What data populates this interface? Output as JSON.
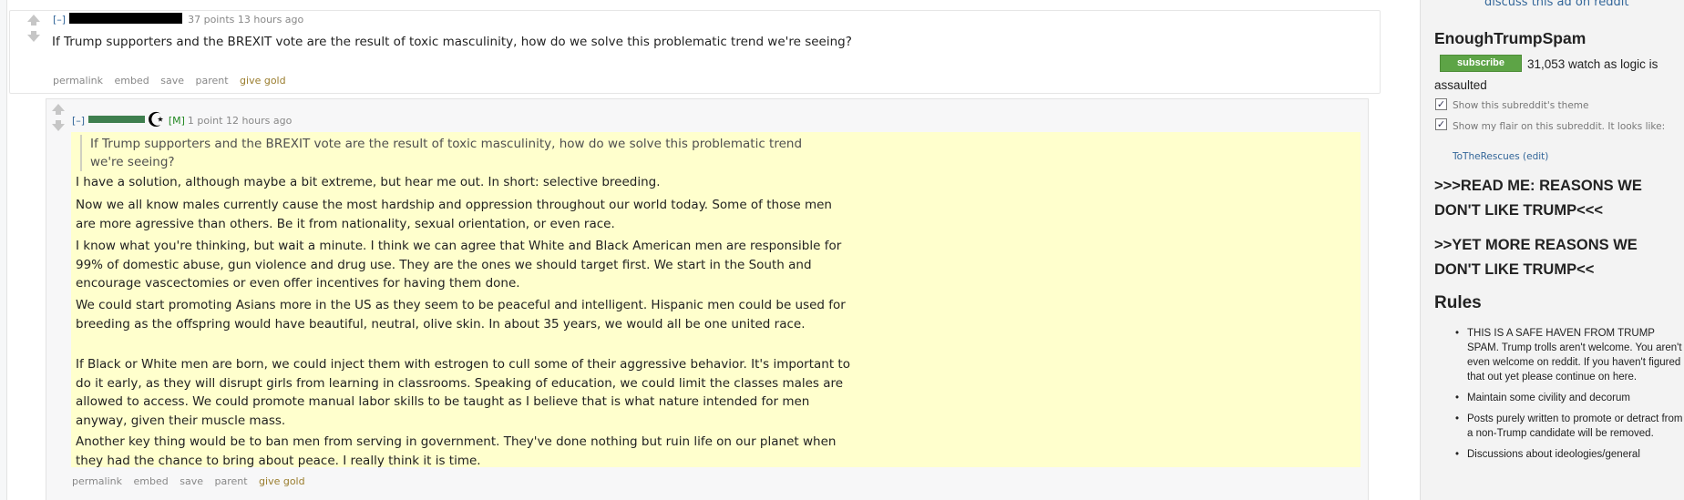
{
  "comment": {
    "expand_label": "[–]",
    "score": "37 points",
    "time": "13 hours ago",
    "body": "If Trump supporters and the BREXIT vote are the result of toxic masculinity, how do we solve this problematic trend we're seeing?",
    "actions": {
      "permalink": "permalink",
      "embed": "embed",
      "save": "save",
      "parent": "parent",
      "give_gold": "give gold"
    }
  },
  "reply": {
    "expand_label": "[–]",
    "mod_tag": "[M]",
    "score": "1 point",
    "time": "12 hours ago",
    "quote": "If Trump supporters and the BREXIT vote are the result of toxic masculinity, how do we solve this problematic trend we're seeing?",
    "paragraphs": [
      "I have a solution, although maybe a bit extreme, but hear me out. In short: selective breeding.",
      "Now we all know males currently cause the most hardship and oppression throughout our world today. Some of those men are more agressive than others. Be it from nationality, sexual orientation, or even race.",
      "I know what you're thinking, but wait a minute. I think we can agree that White and Black American men are responsible for 99% of domestic abuse, gun violence and drug use. They are the ones we should target first. We start in the South and encourage vascectomies or even offer incentives for having them done.",
      "We could start promoting Asians more in the US as they seem to be peaceful and intelligent. Hispanic men could be used for breeding as the offspring would have beautiful, neutral, olive skin. In about 35 years, we would all be one united race.",
      "If Black or White men are born, we could inject them with estrogen to cull some of their aggressive behavior. It's important to do it early, as they will disrupt girls from learning in classrooms. Speaking of education, we could limit the classes males are allowed to access. We could promote manual labor skills to be taught as I believe that is what nature intended for men anyway, given their muscle mass.",
      "Another key thing would be to ban men from serving in government. They've done nothing but ruin life on our planet when they had the chance to bring about peace. I really think it is time."
    ],
    "actions": {
      "permalink": "permalink",
      "embed": "embed",
      "save": "save",
      "parent": "parent",
      "give_gold": "give gold"
    }
  },
  "sidebar": {
    "ad_link": "discuss this ad on reddit",
    "subreddit_name": "EnoughTrumpSpam",
    "subscribe_label": "subscribe",
    "subscriber_text": "31,053 watch as logic is assaulted",
    "show_theme_label": "Show this subreddit's theme",
    "show_flair_label": "Show my flair on this subreddit. It looks like:",
    "flair_user": "ToTheRescues",
    "flair_edit": "(edit)",
    "link1": ">>>READ ME: REASONS WE DON'T LIKE TRUMP<<<",
    "link2": ">>YET MORE REASONS WE DON'T LIKE TRUMP<<",
    "rules_title": "Rules",
    "rules": [
      "THIS IS A SAFE HAVEN FROM TRUMP SPAM. Trump trolls aren't welcome. You aren't even welcome on reddit. If you haven't figured that out yet please continue on here.",
      "Maintain some civility and decorum",
      "Posts purely written to promote or detract from a non-Trump candidate will be removed.",
      "Discussions about ideologies/general"
    ]
  },
  "colors": {
    "gold": "#9a7d2e",
    "subscribe": "#5da446",
    "link": "#336699",
    "highlight": "#ffffcd"
  }
}
